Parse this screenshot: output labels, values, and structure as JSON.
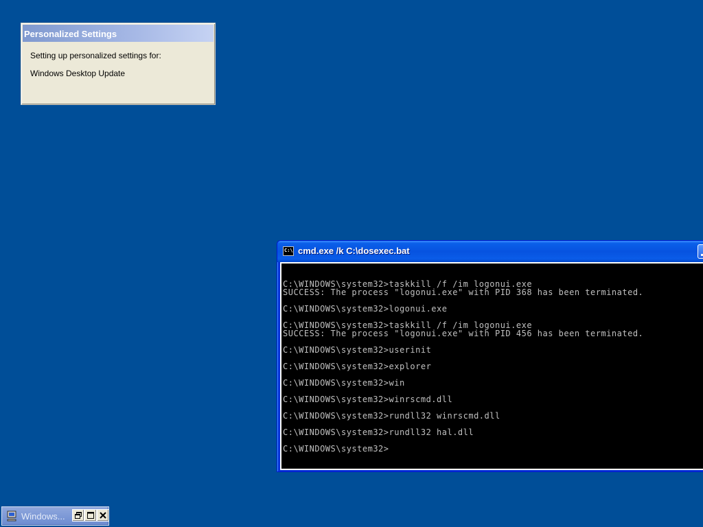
{
  "desktop": {
    "background_color": "#004e98"
  },
  "personalized_settings": {
    "title": "Personalized Settings",
    "line1": "Setting up personalized settings for:",
    "line2": "Windows Desktop Update"
  },
  "cmd": {
    "title": "cmd.exe /k C:\\dosexec.bat",
    "icon_label": "C:\\",
    "icon": "console-icon",
    "minimize_icon": "minimize-icon",
    "lines": [
      "",
      "C:\\WINDOWS\\system32>taskkill /f /im logonui.exe",
      "SUCCESS: The process \"logonui.exe\" with PID 368 has been terminated.",
      "",
      "C:\\WINDOWS\\system32>logonui.exe",
      "",
      "C:\\WINDOWS\\system32>taskkill /f /im logonui.exe",
      "SUCCESS: The process \"logonui.exe\" with PID 456 has been terminated.",
      "",
      "C:\\WINDOWS\\system32>userinit",
      "",
      "C:\\WINDOWS\\system32>explorer",
      "",
      "C:\\WINDOWS\\system32>win",
      "",
      "C:\\WINDOWS\\system32>winrscmd.dll",
      "",
      "C:\\WINDOWS\\system32>rundll32 winrscmd.dll",
      "",
      "C:\\WINDOWS\\system32>rundll32 hal.dll",
      "",
      "C:\\WINDOWS\\system32>"
    ]
  },
  "minimized_window": {
    "title": "Windows...",
    "icon": "computer-icon",
    "restore_icon": "restore-icon",
    "maximize_icon": "maximize-icon",
    "close_icon": "close-icon"
  }
}
